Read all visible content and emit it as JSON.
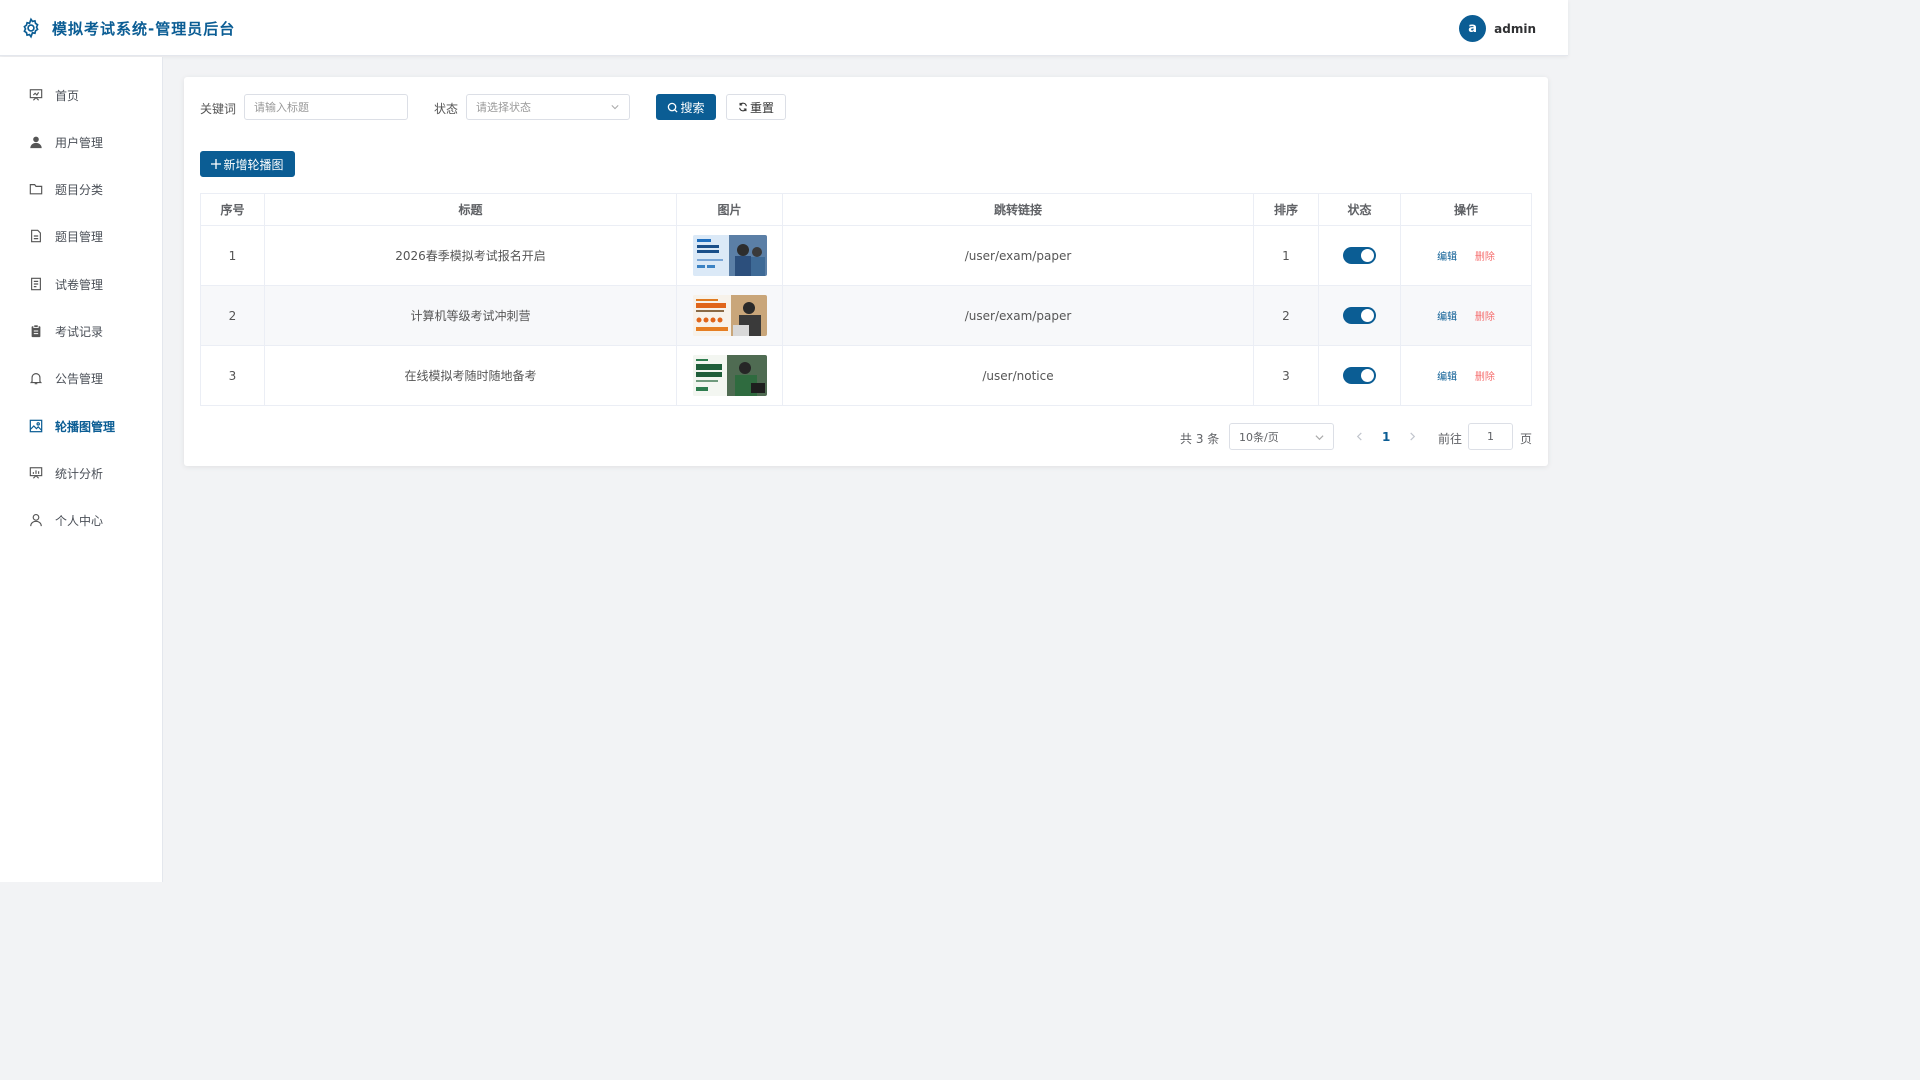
{
  "header": {
    "title": "模拟考试系统-管理员后台",
    "avatar_letter": "a",
    "username": "admin",
    "logo_icon": "gear-icon"
  },
  "sidebar": {
    "items": [
      {
        "label": "首页",
        "icon": "dashboard-icon",
        "active": false
      },
      {
        "label": "用户管理",
        "icon": "user-icon",
        "active": false
      },
      {
        "label": "题目分类",
        "icon": "folder-icon",
        "active": false
      },
      {
        "label": "题目管理",
        "icon": "document-icon",
        "active": false
      },
      {
        "label": "试卷管理",
        "icon": "paper-icon",
        "active": false
      },
      {
        "label": "考试记录",
        "icon": "clipboard-icon",
        "active": false
      },
      {
        "label": "公告管理",
        "icon": "bell-icon",
        "active": false
      },
      {
        "label": "轮播图管理",
        "icon": "picture-icon",
        "active": true
      },
      {
        "label": "统计分析",
        "icon": "chart-icon",
        "active": false
      },
      {
        "label": "个人中心",
        "icon": "person-icon",
        "active": false
      }
    ]
  },
  "filters": {
    "keyword_label": "关键词",
    "keyword_placeholder": "请输入标题",
    "status_label": "状态",
    "status_placeholder": "请选择状态",
    "search_button": "搜索",
    "reset_button": "重置"
  },
  "actions": {
    "add_button": "新增轮播图"
  },
  "table": {
    "columns": [
      "序号",
      "标题",
      "图片",
      "跳转链接",
      "排序",
      "状态",
      "操作"
    ],
    "rows": [
      {
        "index": "1",
        "title": "2026春季模拟考试报名开启",
        "link": "/user/exam/paper",
        "sort": "1",
        "enabled": true
      },
      {
        "index": "2",
        "title": "计算机等级考试冲刺营",
        "link": "/user/exam/paper",
        "sort": "2",
        "enabled": true
      },
      {
        "index": "3",
        "title": "在线模拟考随时随地备考",
        "link": "/user/notice",
        "sort": "3",
        "enabled": true
      }
    ],
    "edit_label": "编辑",
    "delete_label": "删除"
  },
  "pagination": {
    "total_text": "共 3 条",
    "page_size": "10条/页",
    "current_page": "1",
    "goto_label": "前往",
    "goto_value": "1",
    "page_unit": "页"
  },
  "colors": {
    "primary": "#0b5d94",
    "danger": "#f56c6c"
  }
}
